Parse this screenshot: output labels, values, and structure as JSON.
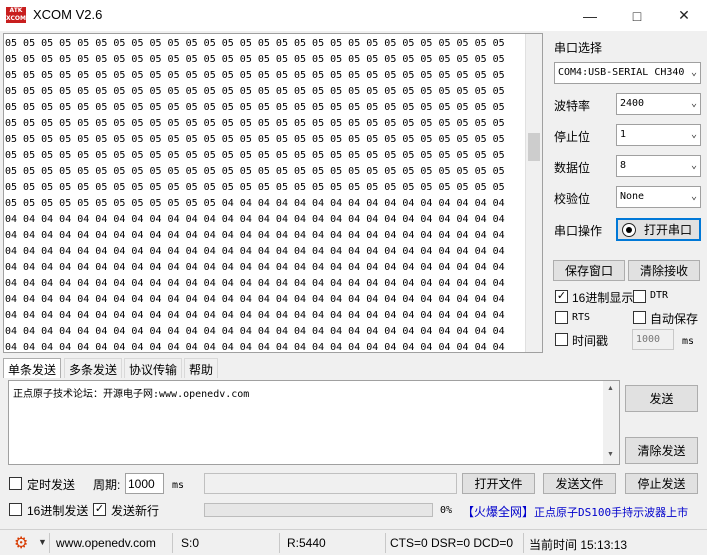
{
  "window": {
    "title": "XCOM V2.6",
    "logo_top": "ATK",
    "logo_bottom": "XCOM"
  },
  "receive": {
    "lines": [
      "05 05 05 05 05 05 05 05 05 05 05 05 05 05 05 05 05 05 05 05 05 05 05 05 05 05 05 05",
      "05 05 05 05 05 05 05 05 05 05 05 05 05 05 05 05 05 05 05 05 05 05 05 05 05 05 05 05",
      "05 05 05 05 05 05 05 05 05 05 05 05 05 05 05 05 05 05 05 05 05 05 05 05 05 05 05 05",
      "05 05 05 05 05 05 05 05 05 05 05 05 05 05 05 05 05 05 05 05 05 05 05 05 05 05 05 05",
      "05 05 05 05 05 05 05 05 05 05 05 05 05 05 05 05 05 05 05 05 05 05 05 05 05 05 05 05",
      "05 05 05 05 05 05 05 05 05 05 05 05 05 05 05 05 05 05 05 05 05 05 05 05 05 05 05 05",
      "05 05 05 05 05 05 05 05 05 05 05 05 05 05 05 05 05 05 05 05 05 05 05 05 05 05 05 05",
      "05 05 05 05 05 05 05 05 05 05 05 05 05 05 05 05 05 05 05 05 05 05 05 05 05 05 05 05",
      "05 05 05 05 05 05 05 05 05 05 05 05 05 05 05 05 05 05 05 05 05 05 05 05 05 05 05 05",
      "05 05 05 05 05 05 05 05 05 05 05 05 05 05 05 05 05 05 05 05 05 05 05 05 05 05 05 05",
      "05 05 05 05 05 05 05 05 05 05 05 05 04 04 04 04 04 04 04 04 04 04 04 04 04 04 04 04",
      "04 04 04 04 04 04 04 04 04 04 04 04 04 04 04 04 04 04 04 04 04 04 04 04 04 04 04 04",
      "04 04 04 04 04 04 04 04 04 04 04 04 04 04 04 04 04 04 04 04 04 04 04 04 04 04 04 04",
      "04 04 04 04 04 04 04 04 04 04 04 04 04 04 04 04 04 04 04 04 04 04 04 04 04 04 04 04",
      "04 04 04 04 04 04 04 04 04 04 04 04 04 04 04 04 04 04 04 04 04 04 04 04 04 04 04 04",
      "04 04 04 04 04 04 04 04 04 04 04 04 04 04 04 04 04 04 04 04 04 04 04 04 04 04 04 04",
      "04 04 04 04 04 04 04 04 04 04 04 04 04 04 04 04 04 04 04 04 04 04 04 04 04 04 04 04",
      "04 04 04 04 04 04 04 04 04 04 04 04 04 04 04 04 04 04 04 04 04 04 04 04 04 04 04 04",
      "04 04 04 04 04 04 04 04 04 04 04 04 04 04 04 04 04 04 04 04 04 04 04 04 04 04 04 04",
      "04 04 04 04 04 04 04 04 04 04 04 04 04 04 04 04 04 04 04 04 04 04 04 04 04 04 04 04",
      "04 04 04 04 04 04 04 04 04 04 04 04 04 04 04 04 04 04 04 04 04 04 04 04 04 04 04 04"
    ]
  },
  "settings": {
    "port_label": "串口选择",
    "port_value": "COM4:USB-SERIAL CH340",
    "baud_label": "波特率",
    "baud_value": "2400",
    "stopbit_label": "停止位",
    "stopbit_value": "1",
    "databit_label": "数据位",
    "databit_value": "8",
    "parity_label": "校验位",
    "parity_value": "None",
    "op_label": "串口操作",
    "open_button": "打开串口",
    "save_window": "保存窗口",
    "clear_receive": "清除接收",
    "hex_display": "16进制显示",
    "hex_display_checked": true,
    "dtr": "DTR",
    "dtr_checked": false,
    "rts": "RTS",
    "rts_checked": false,
    "auto_save": "自动保存",
    "auto_save_checked": false,
    "timestamp": "时间戳",
    "timestamp_checked": false,
    "timestamp_value": "1000",
    "timestamp_unit": "ms"
  },
  "tabs": [
    "单条发送",
    "多条发送",
    "协议传输",
    "帮助"
  ],
  "send": {
    "text": "正点原子技术论坛：开源电子网:www.openedv.com",
    "send_button": "发送",
    "clear_send": "清除发送",
    "timed_send": "定时发送",
    "timed_send_checked": false,
    "period_label": "周期:",
    "period_value": "1000",
    "period_unit": "ms",
    "open_file": "打开文件",
    "send_file": "发送文件",
    "stop_send": "停止发送",
    "hex_send": "16进制发送",
    "hex_send_checked": false,
    "send_newline": "发送新行",
    "send_newline_checked": true,
    "progress_percent": 0,
    "progress_label": "0%",
    "ad_prefix": "【火爆全网】",
    "ad_text": "正点原子DS100手持示波器上市"
  },
  "status": {
    "website": "www.openedv.com",
    "sent": "S:0",
    "received": "R:5440",
    "lines": "CTS=0 DSR=0 DCD=0",
    "time": "当前时间 15:13:13"
  },
  "colors": {
    "accent_link": "#0000cc",
    "gear_icon": "#d83b01",
    "logo_red": "#c81e1e"
  }
}
